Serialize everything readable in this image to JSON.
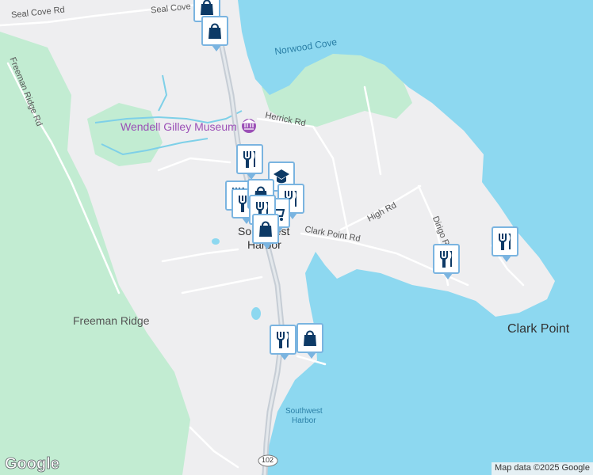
{
  "map": {
    "colors": {
      "water": "#8dd8f0",
      "land": "#eeeef0",
      "park": "#c2ecd2",
      "road": "#ffffff",
      "highway": "#c6cdd5",
      "stream": "#7ed0e8",
      "pin_border": "#7ab4e0",
      "pin_icon": "#0d3a66",
      "museum": "#9b4fb6"
    },
    "labels": {
      "seal_cove_rd": "Seal Cove Rd",
      "norwood_cove": "Norwood Cove",
      "freeman_ridge_rd": "Freeman Ridge Rd",
      "wendell_gilley_museum": "Wendell Gilley Museum",
      "herrick_rd": "Herrick Rd",
      "town_line1": "Southwest",
      "town_line2": "Harbor",
      "clark_point_rd": "Clark Point Rd",
      "high_rd": "High Rd",
      "dirigo_rd": "Dirigo R",
      "freeman_ridge": "Freeman Ridge",
      "clark_point": "Clark Point",
      "harbor_line1": "Southwest",
      "harbor_line2": "Harbor",
      "route_102": "102"
    },
    "pins": [
      {
        "icon": "shopping-bag"
      },
      {
        "icon": "restaurant"
      },
      {
        "icon": "school"
      },
      {
        "icon": "restaurant"
      },
      {
        "icon": "restaurant"
      },
      {
        "icon": "shopping-cart"
      },
      {
        "icon": "shopping-bag"
      },
      {
        "icon": "restaurant"
      },
      {
        "icon": "shopping-bag"
      },
      {
        "icon": "restaurant"
      },
      {
        "icon": "restaurant"
      }
    ],
    "logo": "Google",
    "copyright": "Map data ©2025 Google"
  }
}
